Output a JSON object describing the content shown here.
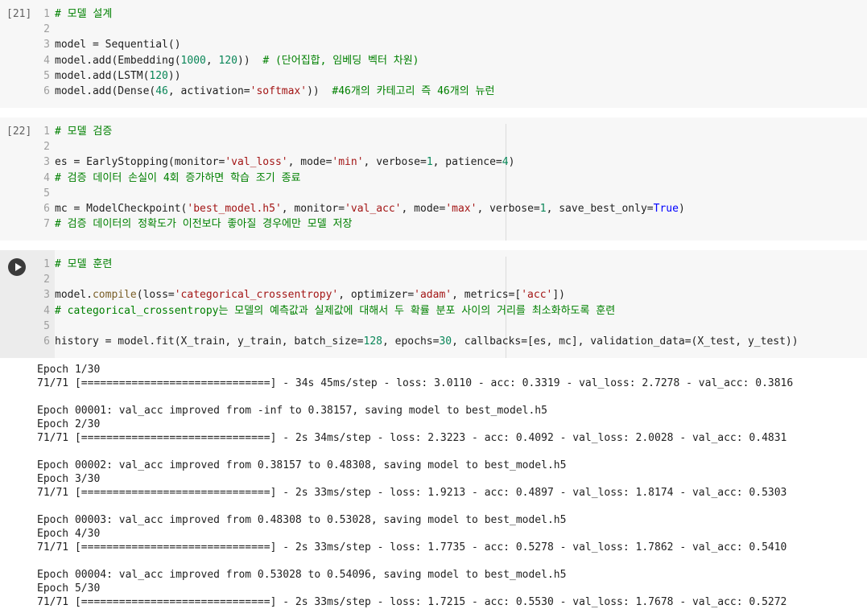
{
  "cells": [
    {
      "exec_count": "[21]",
      "lines": [
        [
          {
            "t": "# 모델 설계",
            "c": "cm"
          }
        ],
        [],
        [
          {
            "t": "model = Sequential()"
          }
        ],
        [
          {
            "t": "model.add(Embedding("
          },
          {
            "t": "1000",
            "c": "nu"
          },
          {
            "t": ", "
          },
          {
            "t": "120",
            "c": "nu"
          },
          {
            "t": "))  "
          },
          {
            "t": "# (단어집합, 임베딩 벡터 차원)",
            "c": "cm"
          }
        ],
        [
          {
            "t": "model.add(LSTM("
          },
          {
            "t": "120",
            "c": "nu"
          },
          {
            "t": "))"
          }
        ],
        [
          {
            "t": "model.add(Dense("
          },
          {
            "t": "46",
            "c": "nu"
          },
          {
            "t": ", activation="
          },
          {
            "t": "'softmax'",
            "c": "st"
          },
          {
            "t": "))  "
          },
          {
            "t": "#46개의 카테고리 즉 46개의 뉴런",
            "c": "cm"
          }
        ]
      ]
    },
    {
      "exec_count": "[22]",
      "lines": [
        [
          {
            "t": "# 모델 검증",
            "c": "cm"
          }
        ],
        [],
        [
          {
            "t": "es = EarlyStopping(monitor="
          },
          {
            "t": "'val_loss'",
            "c": "st"
          },
          {
            "t": ", mode="
          },
          {
            "t": "'min'",
            "c": "st"
          },
          {
            "t": ", verbose="
          },
          {
            "t": "1",
            "c": "nu"
          },
          {
            "t": ", patience="
          },
          {
            "t": "4",
            "c": "nu"
          },
          {
            "t": ")"
          }
        ],
        [
          {
            "t": "# 검증 데이터 손실이 4회 증가하면 학습 조기 종료",
            "c": "cm"
          }
        ],
        [],
        [
          {
            "t": "mc = ModelCheckpoint("
          },
          {
            "t": "'best_model.h5'",
            "c": "st"
          },
          {
            "t": ", monitor="
          },
          {
            "t": "'val_acc'",
            "c": "st"
          },
          {
            "t": ", mode="
          },
          {
            "t": "'max'",
            "c": "st"
          },
          {
            "t": ", verbose="
          },
          {
            "t": "1",
            "c": "nu"
          },
          {
            "t": ", save_best_only="
          },
          {
            "t": "True",
            "c": "kw"
          },
          {
            "t": ")"
          }
        ],
        [
          {
            "t": "# 검증 데이터의 정확도가 이전보다 좋아질 경우에만 모델 저장",
            "c": "cm"
          }
        ]
      ]
    },
    {
      "exec_count": "",
      "lines": [
        [
          {
            "t": "# 모델 훈련",
            "c": "cm"
          }
        ],
        [],
        [
          {
            "t": "model."
          },
          {
            "t": "compile",
            "c": "fn"
          },
          {
            "t": "(loss="
          },
          {
            "t": "'categorical_crossentropy'",
            "c": "st"
          },
          {
            "t": ", optimizer="
          },
          {
            "t": "'adam'",
            "c": "st"
          },
          {
            "t": ", metrics=["
          },
          {
            "t": "'acc'",
            "c": "st"
          },
          {
            "t": "])"
          }
        ],
        [
          {
            "t": "# categorical_crossentropy는 모델의 예측값과 실제값에 대해서 두 확률 분포 사이의 거리를 최소화하도록 훈련",
            "c": "cm"
          }
        ],
        [],
        [
          {
            "t": "history = model.fit(X_train, y_train, batch_size="
          },
          {
            "t": "128",
            "c": "nu"
          },
          {
            "t": ", epochs="
          },
          {
            "t": "30",
            "c": "nu"
          },
          {
            "t": ", callbacks=[es, mc], validation_data=(X_test, y_test))"
          }
        ]
      ]
    }
  ],
  "output_lines": [
    "Epoch 1/30",
    "71/71 [==============================] - 34s 45ms/step - loss: 3.0110 - acc: 0.3319 - val_loss: 2.7278 - val_acc: 0.3816",
    "",
    "Epoch 00001: val_acc improved from -inf to 0.38157, saving model to best_model.h5",
    "Epoch 2/30",
    "71/71 [==============================] - 2s 34ms/step - loss: 2.3223 - acc: 0.4092 - val_loss: 2.0028 - val_acc: 0.4831",
    "",
    "Epoch 00002: val_acc improved from 0.38157 to 0.48308, saving model to best_model.h5",
    "Epoch 3/30",
    "71/71 [==============================] - 2s 33ms/step - loss: 1.9213 - acc: 0.4897 - val_loss: 1.8174 - val_acc: 0.5303",
    "",
    "Epoch 00003: val_acc improved from 0.48308 to 0.53028, saving model to best_model.h5",
    "Epoch 4/30",
    "71/71 [==============================] - 2s 33ms/step - loss: 1.7735 - acc: 0.5278 - val_loss: 1.7862 - val_acc: 0.5410",
    "",
    "Epoch 00004: val_acc improved from 0.53028 to 0.54096, saving model to best_model.h5",
    "Epoch 5/30",
    "71/71 [==============================] - 2s 33ms/step - loss: 1.7215 - acc: 0.5530 - val_loss: 1.7678 - val_acc: 0.5272"
  ],
  "icons": {
    "run": "play-icon"
  }
}
